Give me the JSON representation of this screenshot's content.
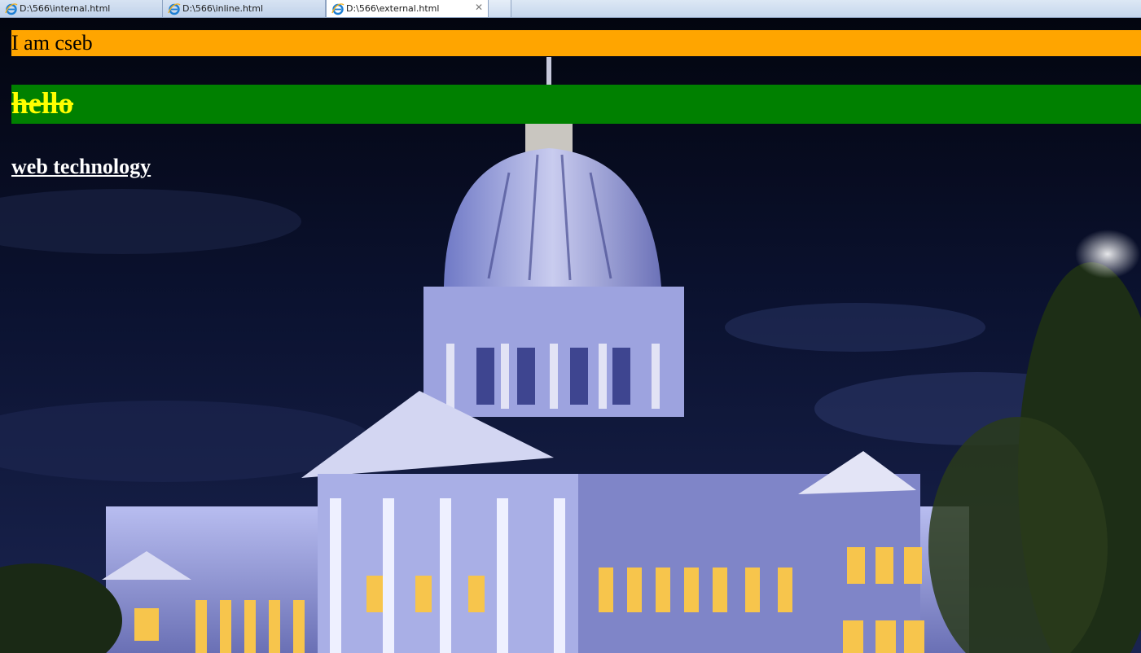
{
  "tabs": [
    {
      "label": "D:\\566\\internal.html",
      "active": false
    },
    {
      "label": "D:\\566\\inline.html",
      "active": false
    },
    {
      "label": "D:\\566\\external.html",
      "active": true
    }
  ],
  "icons": {
    "tab_icon": "ie-browser-icon",
    "close": "close-icon"
  },
  "close_glyph": "✕",
  "content": {
    "paragraph_text": "I am cseb",
    "heading_text": "hello",
    "subheading_text": "web technology"
  },
  "colors": {
    "paragraph_bg": "#ffa500",
    "heading_bg": "#008000",
    "heading_text": "#ffff00",
    "subheading_text": "#ffffff",
    "sky": "#0a0f24"
  },
  "background_image": "night-capitol-dome-building"
}
